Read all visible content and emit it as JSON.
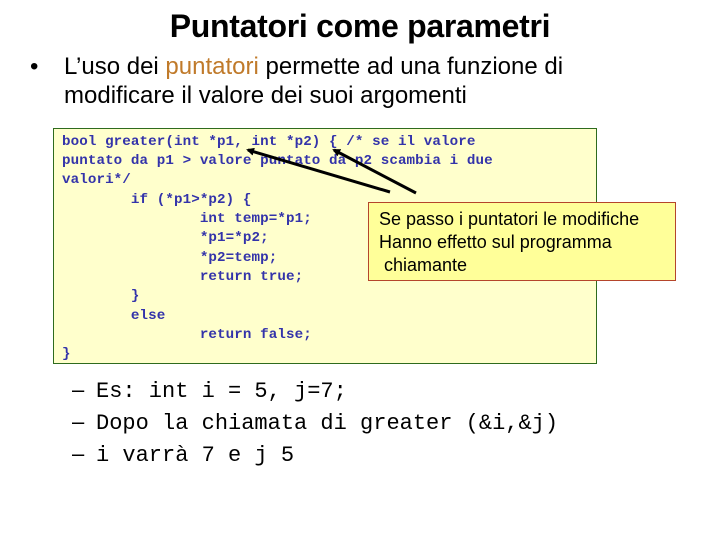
{
  "slide": {
    "title": "Puntatori come parametri",
    "bullet": {
      "marker": "•",
      "text_before": "L’uso dei ",
      "highlight": "puntatori",
      "text_after_line1": " permette ad una funzione di",
      "line2": "modificare il valore dei suoi argomenti",
      "highlight_color": "#c07a2a"
    },
    "code": {
      "lines": [
        "bool greater(int *p1, int *p2) { /* se il valore",
        "puntato da p1 > valore puntato da p2 scambia i due",
        "valori*/",
        "        if (*p1>*p2) {",
        "                int temp=*p1;",
        "                *p1=*p2;",
        "                *p2=temp;",
        "                return true;",
        "        }",
        "        else",
        "                return false;",
        "}"
      ],
      "text_color": "#3333aa",
      "background": "#ffffcc",
      "border_color": "#2e6b1e"
    },
    "callout": {
      "lines": [
        "Se passo i puntatori le modifiche",
        "Hanno effetto sul programma",
        " chiamante"
      ],
      "background": "#ffff99",
      "border_color": "#b5452b",
      "arrow_targets": [
        "p1",
        "p2"
      ]
    },
    "sub_bullets": [
      {
        "dash": "–",
        "text": "Es: int i = 5, j=7;"
      },
      {
        "dash": "–",
        "text": "Dopo la chiamata di greater (&i,&j)"
      },
      {
        "dash": "–",
        "text": "i varrà 7 e j 5"
      }
    ]
  }
}
